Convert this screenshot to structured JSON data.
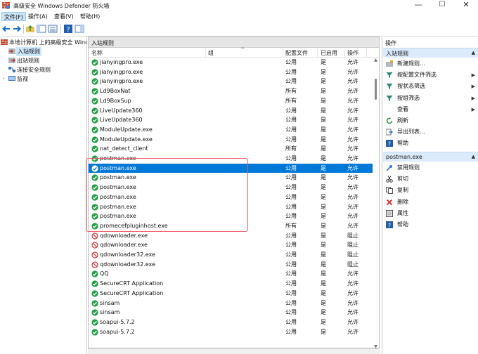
{
  "window": {
    "title": "高级安全 Windows Defender 防火墙",
    "buttons": [
      "—",
      "☐",
      "✕"
    ]
  },
  "menu": [
    {
      "label": "文件(F)",
      "active": true
    },
    {
      "label": "操作(A)",
      "active": false
    },
    {
      "label": "查看(V)",
      "active": false
    },
    {
      "label": "帮助(H)",
      "active": false
    }
  ],
  "toolbar": {
    "icons": [
      "back-arrow-icon",
      "forward-arrow-icon",
      "up-folder-icon",
      "show-hide-tree-icon",
      "show-scope-icon",
      "help-icon",
      "show-hide-action-pane-icon"
    ]
  },
  "tree": {
    "root": "本地计算机 上的高级安全 Windows",
    "items": [
      {
        "label": "入站规则",
        "selected": true,
        "icon": "inbound-rules-icon"
      },
      {
        "label": "出站规则",
        "selected": false,
        "icon": "outbound-rules-icon"
      },
      {
        "label": "连接安全规则",
        "selected": false,
        "icon": "connection-security-icon"
      },
      {
        "label": "监视",
        "selected": false,
        "icon": "monitor-icon"
      }
    ]
  },
  "center": {
    "header": "入站规则",
    "columns": {
      "name": "名称",
      "group": "组",
      "profile": "配置文件",
      "enabled": "已启用",
      "action": "操作"
    },
    "rows": [
      {
        "name": "jianyingpro.exe",
        "profile": "公用",
        "enabled": "是",
        "action": "允许",
        "status": "allow"
      },
      {
        "name": "jianyingpro.exe",
        "profile": "公用",
        "enabled": "是",
        "action": "允许",
        "status": "allow"
      },
      {
        "name": "jianyingpro.exe",
        "profile": "公用",
        "enabled": "是",
        "action": "允许",
        "status": "allow"
      },
      {
        "name": "Ld9BoxNat",
        "profile": "所有",
        "enabled": "是",
        "action": "允许",
        "status": "allow"
      },
      {
        "name": "Ld9BoxSup",
        "profile": "所有",
        "enabled": "是",
        "action": "允许",
        "status": "allow"
      },
      {
        "name": "LiveUpdate360",
        "profile": "公用",
        "enabled": "是",
        "action": "允许",
        "status": "allow"
      },
      {
        "name": "LiveUpdate360",
        "profile": "公用",
        "enabled": "是",
        "action": "允许",
        "status": "allow"
      },
      {
        "name": "ModuleUpdate.exe",
        "profile": "公用",
        "enabled": "是",
        "action": "允许",
        "status": "allow"
      },
      {
        "name": "ModuleUpdate.exe",
        "profile": "公用",
        "enabled": "是",
        "action": "允许",
        "status": "allow"
      },
      {
        "name": "nat_detect_client",
        "profile": "所有",
        "enabled": "是",
        "action": "允许",
        "status": "allow"
      },
      {
        "name": "postman.exe",
        "profile": "公用",
        "enabled": "是",
        "action": "允许",
        "status": "allow"
      },
      {
        "name": "postman.exe",
        "profile": "公用",
        "enabled": "是",
        "action": "允许",
        "status": "allow",
        "selected": true
      },
      {
        "name": "postman.exe",
        "profile": "公用",
        "enabled": "是",
        "action": "允许",
        "status": "allow"
      },
      {
        "name": "postman.exe",
        "profile": "公用",
        "enabled": "是",
        "action": "允许",
        "status": "allow"
      },
      {
        "name": "postman.exe",
        "profile": "公用",
        "enabled": "是",
        "action": "允许",
        "status": "allow"
      },
      {
        "name": "postman.exe",
        "profile": "公用",
        "enabled": "是",
        "action": "允许",
        "status": "allow"
      },
      {
        "name": "postman.exe",
        "profile": "公用",
        "enabled": "是",
        "action": "允许",
        "status": "allow"
      },
      {
        "name": "promecefpluginhost.exe",
        "profile": "所有",
        "enabled": "是",
        "action": "允许",
        "status": "allow"
      },
      {
        "name": "qdownloader.exe",
        "profile": "公用",
        "enabled": "是",
        "action": "阻止",
        "status": "block"
      },
      {
        "name": "qdownloader.exe",
        "profile": "公用",
        "enabled": "是",
        "action": "阻止",
        "status": "block"
      },
      {
        "name": "qdownloader32.exe",
        "profile": "公用",
        "enabled": "是",
        "action": "阻止",
        "status": "block"
      },
      {
        "name": "qdownloader32.exe",
        "profile": "公用",
        "enabled": "是",
        "action": "阻止",
        "status": "block"
      },
      {
        "name": "QQ",
        "profile": "公用",
        "enabled": "是",
        "action": "允许",
        "status": "allow"
      },
      {
        "name": "SecureCRT Application",
        "profile": "公用",
        "enabled": "是",
        "action": "允许",
        "status": "allow"
      },
      {
        "name": "SecureCRT Application",
        "profile": "公用",
        "enabled": "是",
        "action": "允许",
        "status": "allow"
      },
      {
        "name": "sinsam",
        "profile": "公用",
        "enabled": "是",
        "action": "允许",
        "status": "allow"
      },
      {
        "name": "sinsam",
        "profile": "公用",
        "enabled": "是",
        "action": "允许",
        "status": "allow"
      },
      {
        "name": "soapui-5.7.2",
        "profile": "公用",
        "enabled": "是",
        "action": "允许",
        "status": "allow"
      },
      {
        "name": "soapui-5.7.2",
        "profile": "公用",
        "enabled": "是",
        "action": "允许",
        "status": "allow"
      }
    ]
  },
  "actions": {
    "title": "操作",
    "section1": "入站规则",
    "section1_items": [
      {
        "label": "新建规则...",
        "icon": "new-rule-icon",
        "submenu": false
      },
      {
        "label": "按配置文件筛选",
        "icon": "filter-icon",
        "submenu": true
      },
      {
        "label": "按状态筛选",
        "icon": "filter-icon",
        "submenu": true
      },
      {
        "label": "按组筛选",
        "icon": "filter-icon",
        "submenu": true
      },
      {
        "label": "查看",
        "icon": "",
        "submenu": true
      },
      {
        "label": "刷新",
        "icon": "refresh-icon",
        "submenu": false
      },
      {
        "label": "导出列表...",
        "icon": "export-icon",
        "submenu": false
      },
      {
        "label": "帮助",
        "icon": "help-icon",
        "submenu": false
      }
    ],
    "section2": "postman.exe",
    "section2_items": [
      {
        "label": "禁用规则",
        "icon": "disable-rule-icon"
      },
      {
        "label": "剪切",
        "icon": "cut-icon"
      },
      {
        "label": "复制",
        "icon": "copy-icon"
      },
      {
        "label": "删除",
        "icon": "delete-icon"
      },
      {
        "label": "属性",
        "icon": "properties-icon"
      },
      {
        "label": "帮助",
        "icon": "help-icon"
      }
    ]
  },
  "colors": {
    "selection": "#0078d7",
    "allow_green": "#22a045",
    "block_red": "#d8363a",
    "highlight_box": "#f05a68",
    "section_bg": "#dcebfb"
  }
}
